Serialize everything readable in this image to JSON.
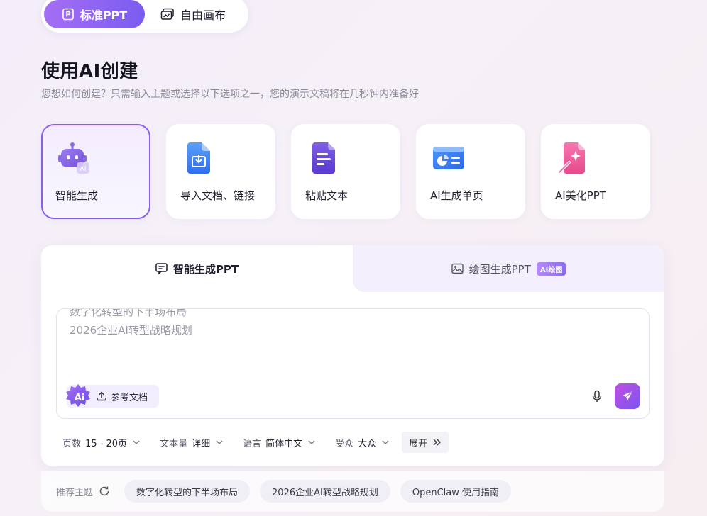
{
  "mode_toggle": {
    "active_label": "标准PPT",
    "inactive_label": "自由画布"
  },
  "header": {
    "title": "使用AI创建",
    "subtitle": "您想如何创建？只需输入主题或选择以下选项之一，您的演示文稿将在几秒钟内准备好"
  },
  "cards": [
    {
      "label": "智能生成",
      "icon": "robot-icon",
      "selected": true
    },
    {
      "label": "导入文档、链接",
      "icon": "import-document-icon",
      "selected": false
    },
    {
      "label": "粘贴文本",
      "icon": "paste-text-icon",
      "selected": false
    },
    {
      "label": "AI生成单页",
      "icon": "single-page-icon",
      "selected": false
    },
    {
      "label": "AI美化PPT",
      "icon": "beautify-icon",
      "selected": false
    }
  ],
  "tabs": {
    "smart": "智能生成PPT",
    "drawing": "绘图生成PPT",
    "drawing_badge": "AI绘图"
  },
  "input": {
    "lines": [
      "数字化转型的下半场布局",
      "2026企业AI转型战略规划"
    ],
    "ai_label": "Ai",
    "reference_doc": "参考文档"
  },
  "options": {
    "pages_label": "页数",
    "pages_value": "15 - 20页",
    "text_label": "文本量",
    "text_value": "详细",
    "lang_label": "语言",
    "lang_value": "简体中文",
    "audience_label": "受众",
    "audience_value": "大众",
    "expand": "展开"
  },
  "suggestions": {
    "label": "推荐主题",
    "items": [
      "数字化转型的下半场布局",
      "2026企业AI转型战略规划",
      "OpenClaw 使用指南"
    ]
  },
  "colors": {
    "accent": "#8b5cf0",
    "accent_gradient_start": "#a56ef5"
  }
}
